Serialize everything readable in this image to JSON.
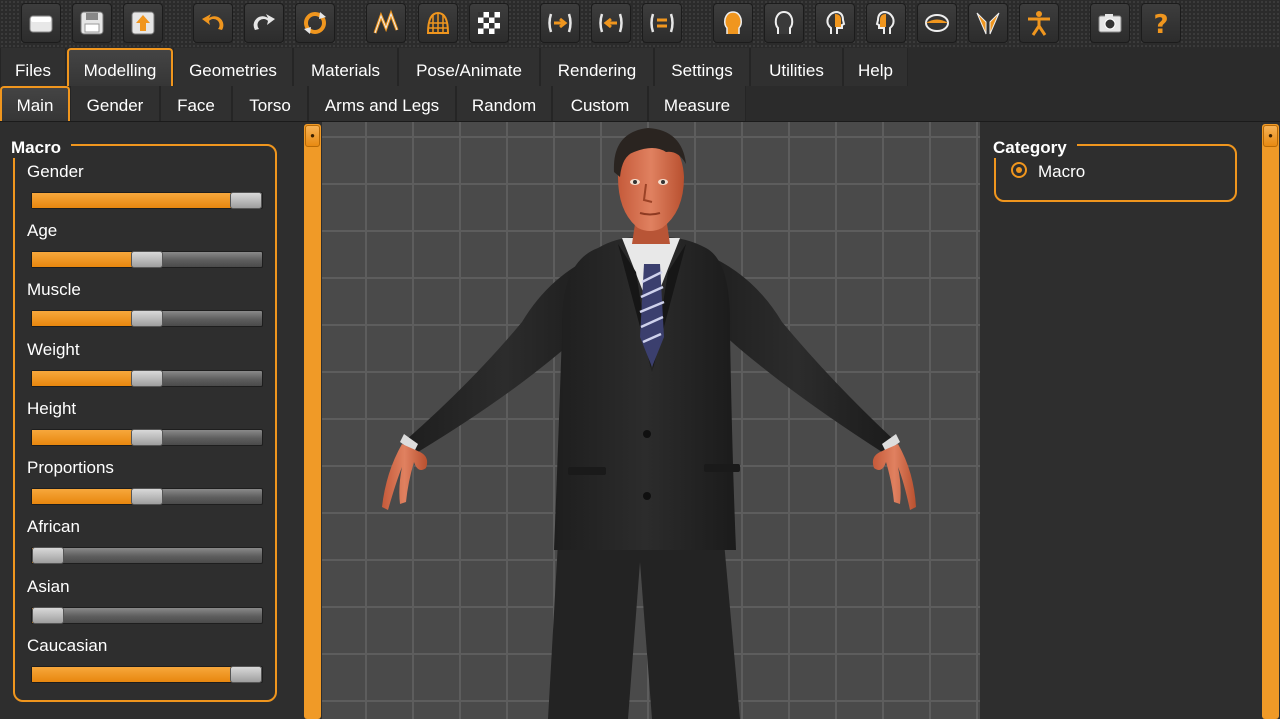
{
  "toolbar": {
    "buttons": [
      {
        "icon": "new-file-icon"
      },
      {
        "icon": "save-icon"
      },
      {
        "icon": "export-icon"
      },
      {
        "icon": "undo-icon"
      },
      {
        "icon": "redo-icon"
      },
      {
        "icon": "reset-icon"
      },
      {
        "icon": "smooth-icon"
      },
      {
        "icon": "wireframe-icon"
      },
      {
        "icon": "background-icon"
      },
      {
        "icon": "symmetry-right-icon"
      },
      {
        "icon": "symmetry-left-icon"
      },
      {
        "icon": "symmetry-icon"
      },
      {
        "icon": "front-view-icon"
      },
      {
        "icon": "back-view-icon"
      },
      {
        "icon": "left-view-icon"
      },
      {
        "icon": "right-view-icon"
      },
      {
        "icon": "top-view-icon"
      },
      {
        "icon": "bottom-view-icon"
      },
      {
        "icon": "reset-camera-icon"
      },
      {
        "icon": "screenshot-icon"
      },
      {
        "icon": "help-icon"
      }
    ]
  },
  "tabs": [
    {
      "label": "Files"
    },
    {
      "label": "Modelling"
    },
    {
      "label": "Geometries"
    },
    {
      "label": "Materials"
    },
    {
      "label": "Pose/Animate"
    },
    {
      "label": "Rendering"
    },
    {
      "label": "Settings"
    },
    {
      "label": "Utilities"
    },
    {
      "label": "Help"
    }
  ],
  "active_tab": "Modelling",
  "subtabs": [
    {
      "label": "Main"
    },
    {
      "label": "Gender"
    },
    {
      "label": "Face"
    },
    {
      "label": "Torso"
    },
    {
      "label": "Arms and Legs"
    },
    {
      "label": "Random"
    },
    {
      "label": "Custom"
    },
    {
      "label": "Measure"
    }
  ],
  "active_subtab": "Main",
  "macro": {
    "title": "Macro",
    "sliders": [
      {
        "label": "Gender",
        "value": 1.0
      },
      {
        "label": "Age",
        "value": 0.5
      },
      {
        "label": "Muscle",
        "value": 0.5
      },
      {
        "label": "Weight",
        "value": 0.5
      },
      {
        "label": "Height",
        "value": 0.5
      },
      {
        "label": "Proportions",
        "value": 0.5
      },
      {
        "label": "African",
        "value": 0.0
      },
      {
        "label": "Asian",
        "value": 0.0
      },
      {
        "label": "Caucasian",
        "value": 1.0
      }
    ]
  },
  "category": {
    "title": "Category",
    "option": "Macro",
    "selected": true
  },
  "colors": {
    "accent": "#f0961e",
    "panel": "#2e2e2e",
    "viewport": "#4a4a4a",
    "grid": "#5d5d5d"
  }
}
